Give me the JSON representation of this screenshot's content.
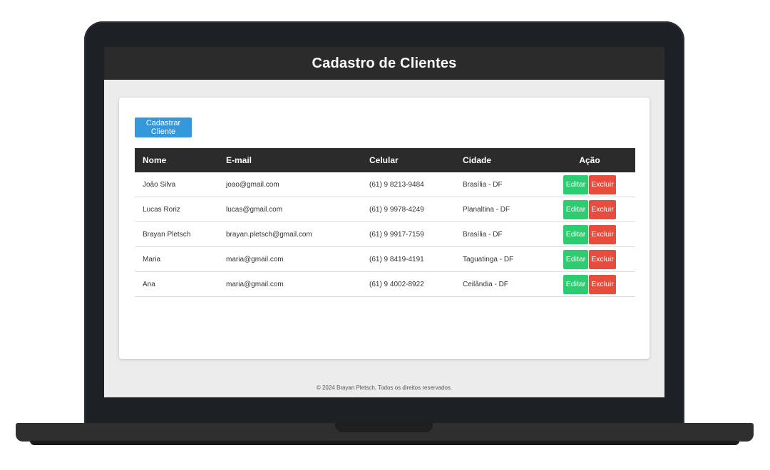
{
  "app": {
    "title": "Cadastro de Clientes",
    "add_button_label": "Cadastrar Cliente",
    "footer": "© 2024 Brayan Pletsch. Todos os direitos reservados."
  },
  "table": {
    "headers": {
      "nome": "Nome",
      "email": "E-mail",
      "celular": "Celular",
      "cidade": "Cidade",
      "acao": "Ação"
    },
    "edit_label": "Editar",
    "delete_label": "Excluir",
    "rows": [
      {
        "nome": "João Silva",
        "email": "joao@gmail.com",
        "celular": "(61) 9 8213-9484",
        "cidade": "Brasília - DF"
      },
      {
        "nome": "Lucas Roriz",
        "email": "lucas@gmail.com",
        "celular": "(61) 9 9978-4249",
        "cidade": "Planaltina - DF"
      },
      {
        "nome": "Brayan Pletsch",
        "email": "brayan.pletsch@gmail.com",
        "celular": "(61) 9 9917-7159",
        "cidade": "Brasília - DF"
      },
      {
        "nome": "Maria",
        "email": "maria@gmail.com",
        "celular": "(61) 9 8419-4191",
        "cidade": "Taguatinga - DF"
      },
      {
        "nome": "Ana",
        "email": "maria@gmail.com",
        "celular": "(61) 9 4002-8922",
        "cidade": "Ceilândia - DF"
      }
    ]
  },
  "colors": {
    "header_bg": "#2b2b2b",
    "primary": "#3498db",
    "edit": "#2ecc71",
    "delete": "#e74c3c"
  }
}
